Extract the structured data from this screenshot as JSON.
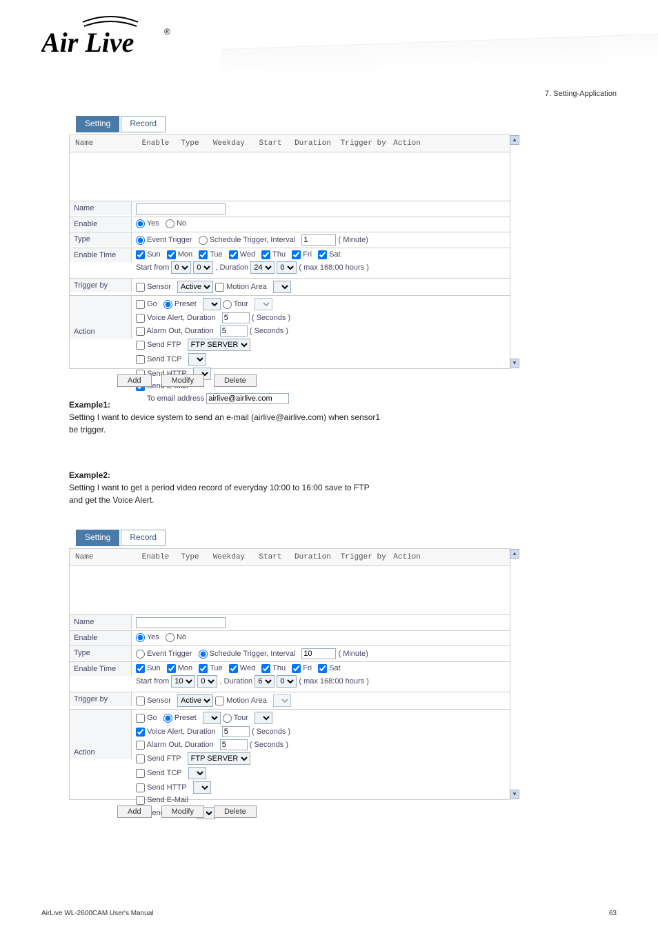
{
  "header": {
    "brand": "Air Live",
    "page_num_top": "7. Setting-Application",
    "section": "7. Setting-Application"
  },
  "tabs": {
    "setting": "Setting",
    "record": "Record"
  },
  "list_headers": {
    "name": "Name",
    "enable": "Enable",
    "type": "Type",
    "weekday": "Weekday",
    "start": "Start",
    "duration": "Duration",
    "trigger": "Trigger by",
    "action": "Action"
  },
  "labels": {
    "name": "Name",
    "enable": "Enable",
    "type": "Type",
    "enable_time": "Enable Time",
    "trigger_by": "Trigger by",
    "action": "Action"
  },
  "common": {
    "yes": "Yes",
    "no": "No",
    "event_trigger": "Event Trigger",
    "schedule_trigger": "Schedule Trigger, Interval",
    "minute": "( Minute)",
    "days": {
      "sun": "Sun",
      "mon": "Mon",
      "tue": "Tue",
      "wed": "Wed",
      "thu": "Thu",
      "fri": "Fri",
      "sat": "Sat"
    },
    "start_from": "Start from",
    "duration": ", Duration",
    "max_hours": "( max 168:00 hours )",
    "sensor": "Sensor",
    "sensor_val": "Active",
    "motion_area": "Motion Area",
    "go": "Go",
    "preset": "Preset",
    "tour": "Tour",
    "voice_alert": "Voice Alert, Duration",
    "seconds": "( Seconds )",
    "alarm_out": "Alarm Out, Duration",
    "send_ftp": "Send FTP",
    "ftp_val": "FTP SERVER",
    "send_tcp": "Send TCP",
    "send_http": "Send HTTP",
    "send_email": "Send E-Mail",
    "to_email": "To email address",
    "send_samba": "Send Samba",
    "add": "Add",
    "modify": "Modify",
    "delete": "Delete"
  },
  "panel1": {
    "type_event": true,
    "interval": "1",
    "start_h": "0",
    "start_m": "0",
    "dur_h": "24",
    "dur_m": "0",
    "voice_dur": "5",
    "alarm_dur": "5",
    "email_addr": "airlive@airlive.com"
  },
  "panel2": {
    "type_event": false,
    "interval": "10",
    "start_h": "10",
    "start_m": "0",
    "dur_h": "6",
    "dur_m": "0",
    "voice_dur": "5",
    "alarm_dur": "5"
  },
  "body1": {
    "title": "Example1:",
    "l1": "Setting I want to device system to send an e-mail (airlive@airlive.com) when sensor1",
    "l2": "be trigger."
  },
  "body2": {
    "title": "Example2:",
    "l1": "Setting I want to get a period video record of everyday 10:00 to 16:00 save to FTP",
    "l2": "and get the Voice Alert."
  },
  "footer": {
    "left": "AirLive WL-2600CAM User's Manual",
    "right": "63"
  }
}
